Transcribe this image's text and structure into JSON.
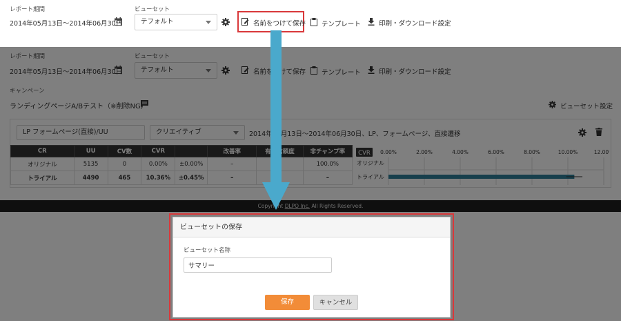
{
  "top": {
    "report_period_label": "レポート期間",
    "report_period_value": "2014年05月13日〜2014年06月30日",
    "viewset_label": "ビューセット",
    "viewset_value": "テフォルト",
    "save_as_label": "名前をつけて保存",
    "template_label": "テンプレート",
    "print_label": "印刷・ダウンロード設定"
  },
  "campaign": {
    "label": "キャンペーン",
    "name": "ランディングページA/Bテスト（※削除NG）",
    "viewset_settings_label": "ビューセット設定"
  },
  "panel": {
    "page_filter": "LP フォームページ(直接)/UU",
    "creative_select": "クリエイティブ",
    "summary": "2014年05月13日〜2014年06月30日、LP、フォームページ、直接遷移"
  },
  "table": {
    "headers": [
      "CR",
      "UU",
      "CV数",
      "CVR",
      "",
      "改善率",
      "有意信頼度",
      "非チャンプ率"
    ],
    "rows": [
      [
        "オリジナル",
        "5135",
        "0",
        "0.00%",
        "±0.00%",
        "–",
        "–",
        "100.0%"
      ],
      [
        "トライアル",
        "4490",
        "465",
        "10.36%",
        "±0.45%",
        "–",
        "–",
        "–"
      ]
    ]
  },
  "chart_data": {
    "type": "bar",
    "title": "CVR",
    "categories": [
      "オリジナル",
      "トライアル"
    ],
    "values": [
      0.0,
      10.36
    ],
    "error": [
      0.0,
      0.45
    ],
    "xlim": [
      0,
      12
    ],
    "xticks": [
      "0.00%",
      "2.00%",
      "4.00%",
      "6.00%",
      "8.00%",
      "10.00%",
      "12.00%"
    ],
    "bar_color": "#2e7f99"
  },
  "footer": {
    "prefix": "Copyright ",
    "link": "DLPO Inc.",
    "suffix": " All Rights Reserved."
  },
  "modal": {
    "title": "ビューセットの保存",
    "field_label": "ビューセット名称",
    "field_value": "サマリー",
    "save_label": "保存",
    "cancel_label": "キャンセル"
  },
  "colors": {
    "highlight": "#d9383a",
    "arrow": "#4aa9cc",
    "save_button": "#f28c38"
  }
}
